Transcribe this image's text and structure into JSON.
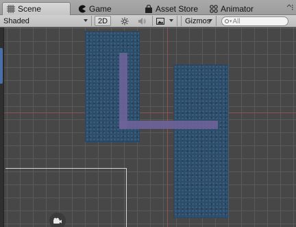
{
  "tabs": [
    {
      "label": "Scene",
      "icon": "scene-grid-icon",
      "active": true
    },
    {
      "label": "Game",
      "icon": "pacman-icon",
      "active": false
    },
    {
      "label": "Asset Store",
      "icon": "shopping-bag-icon",
      "active": false
    },
    {
      "label": "Animator",
      "icon": "animator-icon",
      "active": false
    }
  ],
  "toolbar": {
    "shading_mode": "Shaded",
    "mode_2d_label": "2D",
    "gizmos_label": "Gizmos",
    "search_placeholder": "All"
  },
  "colors": {
    "tile": "#2e4d6a",
    "path": "#6e6399",
    "axis": "#7a5a5a",
    "grid": "#5a5a5a"
  }
}
